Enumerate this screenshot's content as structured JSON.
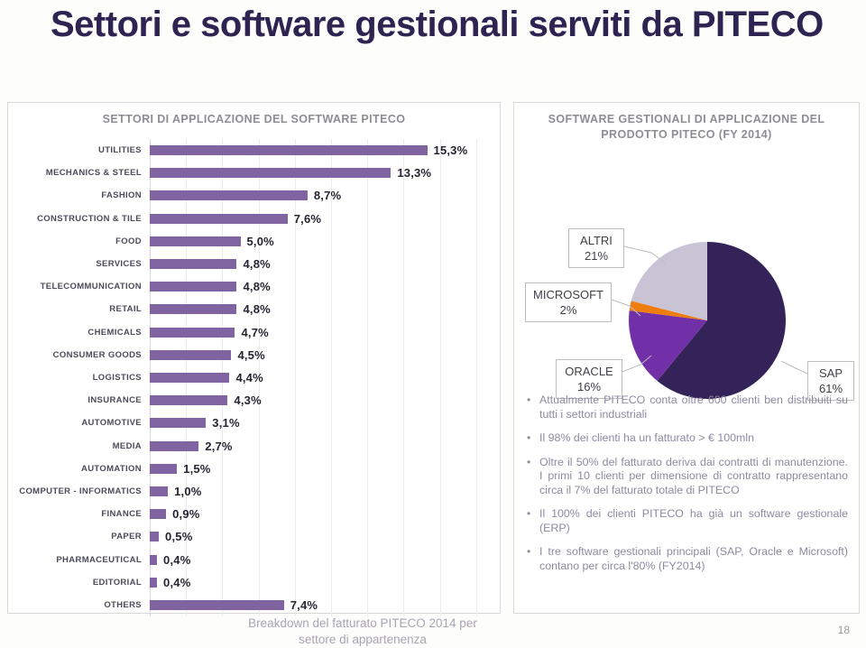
{
  "slide": {
    "title": "Settori e software gestionali serviti da PITECO",
    "page_number": "18"
  },
  "left_panel": {
    "title": "SETTORI DI APPLICAZIONE DEL SOFTWARE PITECO",
    "caption": "Breakdown del fatturato PITECO 2014 per settore di appartenenza"
  },
  "right_panel": {
    "title_line1": "SOFTWARE GESTIONALI DI APPLICAZIONE DEL",
    "title_line2": "PRODOTTO PITECO (FY 2014)"
  },
  "chart_data": [
    {
      "type": "bar",
      "orientation": "horizontal",
      "title": "SETTORI DI APPLICAZIONE DEL SOFTWARE PITECO",
      "subtitle": "Breakdown del fatturato PITECO 2014 per settore di appartenenza",
      "xlabel": "",
      "ylabel": "",
      "xlim": [
        0,
        19
      ],
      "grid": true,
      "grid_step": 2,
      "tick_labels_visible": false,
      "bar_color": "#8064a2",
      "categories": [
        "UTILITIES",
        "MECHANICS & STEEL",
        "FASHION",
        "CONSTRUCTION & TILE",
        "FOOD",
        "SERVICES",
        "TELECOMMUNICATION",
        "RETAIL",
        "CHEMICALS",
        "CONSUMER GOODS",
        "LOGISTICS",
        "INSURANCE",
        "AUTOMOTIVE",
        "MEDIA",
        "AUTOMATION",
        "COMPUTER - INFORMATICS",
        "FINANCE",
        "PAPER",
        "PHARMACEUTICAL",
        "EDITORIAL",
        "OTHERS"
      ],
      "values": [
        15.3,
        13.3,
        8.7,
        7.6,
        5.0,
        4.8,
        4.8,
        4.8,
        4.7,
        4.5,
        4.4,
        4.3,
        3.1,
        2.7,
        1.5,
        1.0,
        0.9,
        0.5,
        0.4,
        0.4,
        7.4
      ],
      "value_labels": [
        "15,3%",
        "13,3%",
        "8,7%",
        "7,6%",
        "5,0%",
        "4,8%",
        "4,8%",
        "4,8%",
        "4,7%",
        "4,5%",
        "4,4%",
        "4,3%",
        "3,1%",
        "2,7%",
        "1,5%",
        "1,0%",
        "0,9%",
        "0,5%",
        "0,4%",
        "0,4%",
        "7,4%"
      ]
    },
    {
      "type": "pie",
      "title": "SOFTWARE GESTIONALI DI APPLICAZIONE DEL PRODOTTO PITECO (FY 2014)",
      "legend": "callout-boxes",
      "start_angle_deg": 0,
      "direction": "clockwise",
      "labels": [
        "SAP",
        "ORACLE",
        "MICROSOFT",
        "ALTRI"
      ],
      "values": [
        61,
        16,
        2,
        21
      ],
      "value_labels": [
        "61%",
        "16%",
        "2%",
        "21%"
      ],
      "colors": [
        "#332359",
        "#7230a8",
        "#ee7d0e",
        "#c8c4d6"
      ]
    }
  ],
  "bullets": [
    "Attualmente PITECO conta oltre 600 clienti ben distribuiti su tutti i settori industriali",
    "Il 98% dei clienti ha un fatturato > € 100mln",
    "Oltre il 50% del fatturato deriva dai contratti di manutenzione. I primi 10 clienti per dimensione di contratto rappresentano circa il 7% del fatturato totale di PITECO",
    "Il 100% dei clienti PITECO ha già un software gestionale (ERP)",
    "I tre software gestionali principali (SAP, Oracle e Microsoft) contano per circa l'80% (FY2014)"
  ],
  "bullet_marker": "•"
}
